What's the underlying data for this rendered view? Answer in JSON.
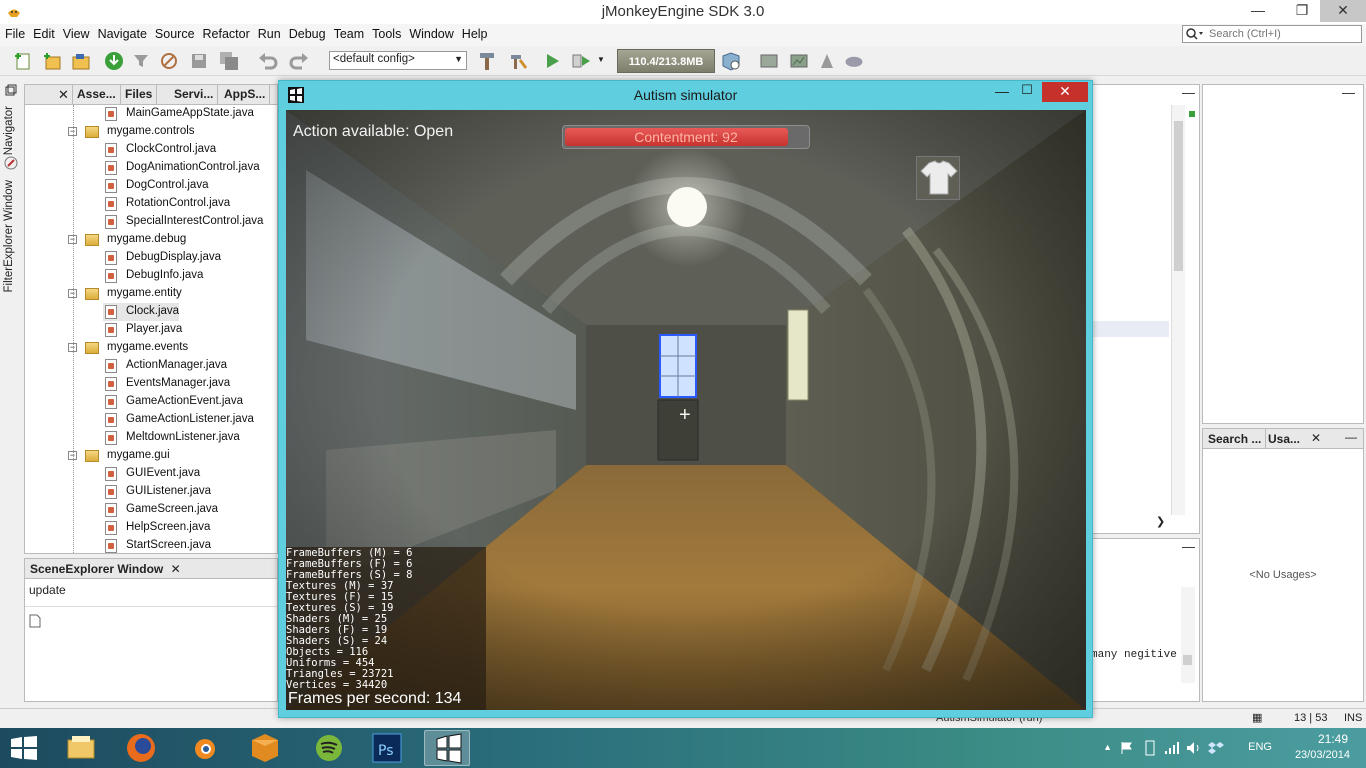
{
  "ide": {
    "title": "jMonkeyEngine SDK 3.0",
    "menu": [
      "File",
      "Edit",
      "View",
      "Navigate",
      "Source",
      "Refactor",
      "Run",
      "Debug",
      "Team",
      "Tools",
      "Window",
      "Help"
    ],
    "search_placeholder": "Search (Ctrl+I)",
    "config_value": "<default config>",
    "memory": "110.4/213.8MB"
  },
  "sidebar_vtabs": [
    "Navigator",
    "FilterExplorer Window"
  ],
  "projects": {
    "tabs": [
      "Asse...",
      "Files",
      "Servi...",
      "AppS..."
    ],
    "tree": [
      {
        "type": "file",
        "label": "MainGameAppState.java"
      },
      {
        "type": "package",
        "label": "mygame.controls"
      },
      {
        "type": "file",
        "label": "ClockControl.java"
      },
      {
        "type": "file",
        "label": "DogAnimationControl.java"
      },
      {
        "type": "file",
        "label": "DogControl.java"
      },
      {
        "type": "file",
        "label": "RotationControl.java"
      },
      {
        "type": "file",
        "label": "SpecialInterestControl.java"
      },
      {
        "type": "package",
        "label": "mygame.debug"
      },
      {
        "type": "file",
        "label": "DebugDisplay.java"
      },
      {
        "type": "file",
        "label": "DebugInfo.java"
      },
      {
        "type": "package",
        "label": "mygame.entity"
      },
      {
        "type": "file",
        "label": "Clock.java",
        "selected": true
      },
      {
        "type": "file",
        "label": "Player.java"
      },
      {
        "type": "package",
        "label": "mygame.events"
      },
      {
        "type": "file",
        "label": "ActionManager.java"
      },
      {
        "type": "file",
        "label": "EventsManager.java"
      },
      {
        "type": "file",
        "label": "GameActionEvent.java"
      },
      {
        "type": "file",
        "label": "GameActionListener.java"
      },
      {
        "type": "file",
        "label": "MeltdownListener.java"
      },
      {
        "type": "package",
        "label": "mygame.gui"
      },
      {
        "type": "file",
        "label": "GUIEvent.java"
      },
      {
        "type": "file",
        "label": "GUIListener.java"
      },
      {
        "type": "file",
        "label": "GameScreen.java"
      },
      {
        "type": "file",
        "label": "HelpScreen.java"
      },
      {
        "type": "file",
        "label": "StartScreen.java"
      }
    ]
  },
  "scene_explorer": {
    "tab": "SceneExplorer Window",
    "value": "update"
  },
  "usages": {
    "tabs": [
      "Search ...",
      "Usa..."
    ],
    "empty": "<No Usages>"
  },
  "output": {
    "line": "many negitive"
  },
  "statusbar": {
    "running": "AutismSimulator (run)",
    "position": "13 | 53",
    "mode": "INS"
  },
  "taskbar": {
    "lang": "ENG",
    "time": "21:49",
    "date": "23/03/2014"
  },
  "game": {
    "title": "Autism simulator",
    "action_text": "Action available: Open",
    "contentment_label": "Contentment: 92",
    "contentment_level": 0.92,
    "stats": [
      "FrameBuffers (M) = 6",
      "FrameBuffers (F) = 6",
      "FrameBuffers (S) = 8",
      "Textures (M) = 37",
      "Textures (F) = 15",
      "Textures (S) = 19",
      "Shaders (M) = 25",
      "Shaders (F) = 19",
      "Shaders (S) = 24",
      "Objects = 116",
      "Uniforms = 454",
      "Triangles = 23721",
      "Vertices = 34420"
    ],
    "fps_text": "Frames per second: 134"
  }
}
